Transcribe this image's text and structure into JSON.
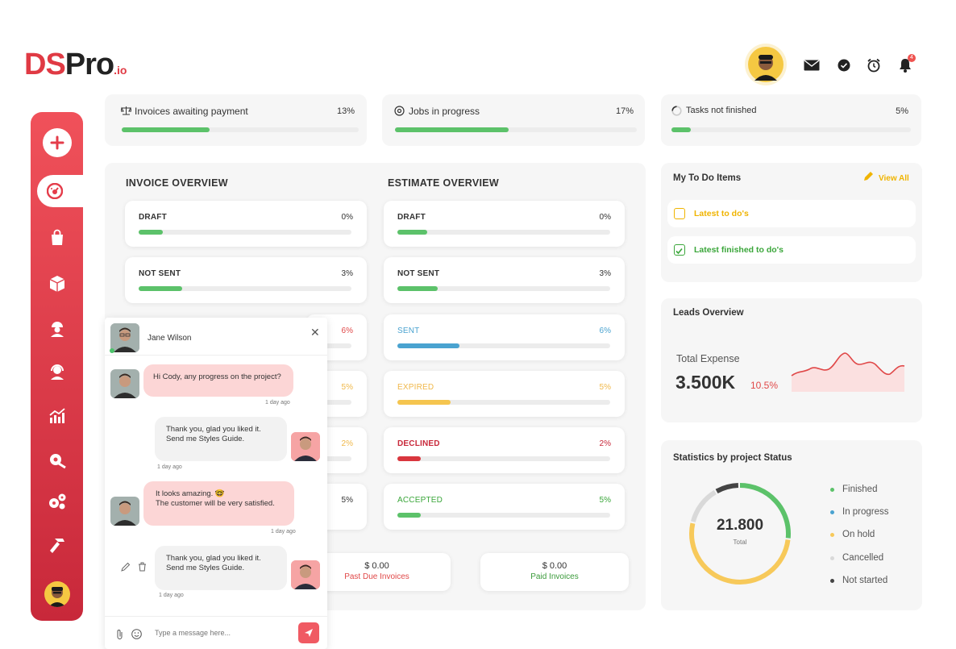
{
  "brand": {
    "logo_main": "DS",
    "logo_rest": "Pro",
    "logo_suffix": ".io"
  },
  "header": {
    "icons": [
      "mail-icon",
      "check-circle-icon",
      "alarm-clock-icon",
      "bell-icon"
    ],
    "bell_badge": "4"
  },
  "stats": [
    {
      "label": "Invoices awaiting payment",
      "pct": "13%",
      "fill": 0.37,
      "icon": "scale-icon"
    },
    {
      "label": "Jobs in progress",
      "pct": "17%",
      "fill": 0.47,
      "icon": "gauge-icon"
    },
    {
      "label": "Tasks not finished",
      "pct": "5%",
      "fill": 0.08,
      "icon": "circle-progress-icon"
    }
  ],
  "invoice_overview": {
    "title": "INVOICE OVERVIEW",
    "rows": [
      {
        "label": "DRAFT",
        "pct": "0%"
      },
      {
        "label": "NOT SENT",
        "pct": "3%"
      },
      {
        "label": "",
        "pct": "6%"
      },
      {
        "label": "",
        "pct": "5%"
      },
      {
        "label": "",
        "pct": "2%"
      },
      {
        "label": "",
        "pct": "5%"
      }
    ]
  },
  "estimate_overview": {
    "title": "ESTIMATE OVERVIEW",
    "rows": [
      {
        "label": "DRAFT",
        "pct": "0%",
        "color": "#5cc26a",
        "fill": 0.14
      },
      {
        "label": "NOT SENT",
        "pct": "3%",
        "color": "#5cc26a",
        "fill": 0.19
      },
      {
        "label": "SENT",
        "pct": "6%",
        "color": "#4aa3d0",
        "fill": 0.29
      },
      {
        "label": "EXPIRED",
        "pct": "5%",
        "color": "#f5c54f",
        "fill": 0.25
      },
      {
        "label": "DECLINED",
        "pct": "2%",
        "color": "#d9363e",
        "fill": 0.11
      },
      {
        "label": "ACCEPTED",
        "pct": "5%",
        "color": "#5cc26a",
        "fill": 0.11
      }
    ]
  },
  "invoice_totals": [
    {
      "amount": "$ 0.00",
      "label": "Past Due Invoices",
      "color": "#e04848"
    },
    {
      "amount": "$ 0.00",
      "label": "Paid Invoices",
      "color": "#3a9a3a"
    }
  ],
  "todo": {
    "title": "My To Do Items",
    "view_all": "View All",
    "items": [
      {
        "label": "Latest to do's",
        "color": "#f0b400"
      },
      {
        "label": "Latest finished to do's",
        "color": "#3aa63a"
      }
    ]
  },
  "leads": {
    "title": "Leads Overview",
    "expense_label": "Total Expense",
    "expense_value": "3.500K",
    "change": "10.5%"
  },
  "project_status": {
    "title": "Statistics by project Status",
    "total": "21.800",
    "total_label": "Total",
    "legend": [
      {
        "label": "Finished",
        "color": "#5cc26a",
        "value": 0.27
      },
      {
        "label": "In progress",
        "color": "#4aa3d0",
        "value": 0
      },
      {
        "label": "On hold",
        "color": "#f7c95a",
        "value": 0.52
      },
      {
        "label": "Cancelled",
        "color": "#d9d9d9",
        "value": 0.13
      },
      {
        "label": "Not started",
        "color": "#444444",
        "value": 0.08
      }
    ]
  },
  "chat": {
    "contact": "Jane Wilson",
    "placeholder": "Type a message here...",
    "messages": [
      {
        "dir": "in",
        "text": "Hi Cody, any progress on the project?",
        "time": "1 day ago"
      },
      {
        "dir": "out",
        "text": "Thank you, glad you liked it.\nSend me Styles Guide.",
        "time": "1 day ago"
      },
      {
        "dir": "in",
        "text": "It looks amazing.  🤓\nThe customer will be very satisfied.",
        "time": "1 day ago"
      },
      {
        "dir": "out",
        "text": "Thank you, glad you liked it.\nSend me Styles Guide.",
        "time": "1 day ago"
      }
    ]
  }
}
